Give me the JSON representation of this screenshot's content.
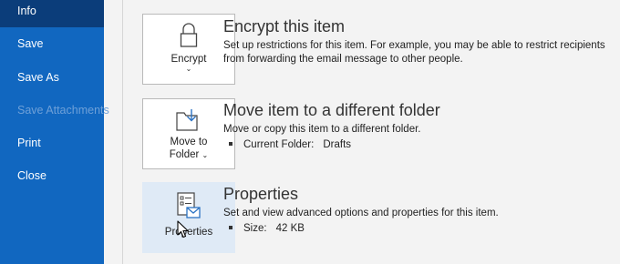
{
  "nav": {
    "items": [
      {
        "label": "Info",
        "state": "active"
      },
      {
        "label": "Save",
        "state": "normal"
      },
      {
        "label": "Save As",
        "state": "normal"
      },
      {
        "label": "Save Attachments",
        "state": "disabled"
      },
      {
        "label": "Print",
        "state": "normal"
      },
      {
        "label": "Close",
        "state": "normal"
      }
    ]
  },
  "sections": {
    "encrypt": {
      "tile_label": "Encrypt",
      "tile_chevron": "⌄",
      "icon": "lock-icon",
      "heading": "Encrypt this item",
      "description": "Set up restrictions for this item. For example, you may be able to restrict recipients from forwarding the email message to other people."
    },
    "move": {
      "tile_label_line1": "Move to",
      "tile_label_line2": "Folder",
      "tile_chevron": "⌄",
      "icon": "folder-move-icon",
      "heading": "Move item to a different folder",
      "description": "Move or copy this item to a different folder.",
      "detail_label": "Current Folder:",
      "detail_value": "Drafts"
    },
    "properties": {
      "tile_label": "Properties",
      "icon": "properties-icon",
      "heading": "Properties",
      "description": "Set and view advanced options and properties for this item.",
      "detail_label": "Size:",
      "detail_value": "42 KB"
    }
  },
  "colors": {
    "nav_background": "#1167c0",
    "nav_active": "#0b3d7a",
    "nav_disabled_text": "#6ea0d8",
    "tile_hover": "#dfeaf6",
    "content_background": "#f3f3f3"
  }
}
